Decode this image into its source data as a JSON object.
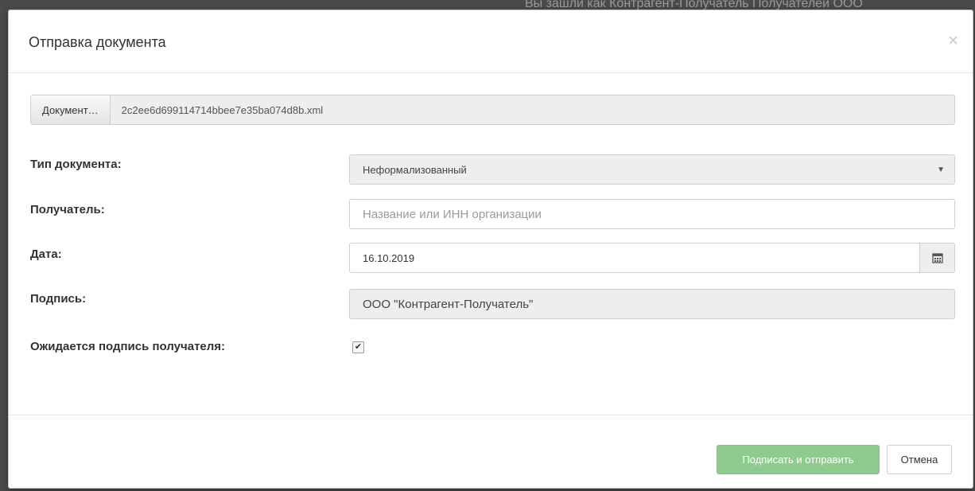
{
  "background": {
    "header_text": "Вы зашли как    Контрагент-Получатель Получателей ООО"
  },
  "modal": {
    "title": "Отправка документа",
    "close_symbol": "×"
  },
  "file": {
    "button_label": "Документ…",
    "file_name": "2c2ee6d699114714bbee7e35ba074d8b.xml"
  },
  "form": {
    "doc_type_label": "Тип документа:",
    "doc_type_value": "Неформализованный",
    "recipient_label": "Получатель:",
    "recipient_placeholder": "Название или ИНН организации",
    "date_label": "Дата:",
    "date_value": "16.10.2019",
    "signature_label": "Подпись:",
    "signature_value": "ООО \"Контрагент-Получатель\"",
    "await_signature_label": "Ожидается подпись получателя:",
    "await_signature_checked": true
  },
  "footer": {
    "sign_send_label": "Подписать и отправить",
    "cancel_label": "Отмена"
  },
  "icons": {
    "calendar": "calendar-icon",
    "caret": "chevron-down-icon",
    "close": "close-icon",
    "check": "check-icon"
  },
  "colors": {
    "primary_disabled": "#8fcb8f",
    "backdrop": "#4a4a4a"
  }
}
